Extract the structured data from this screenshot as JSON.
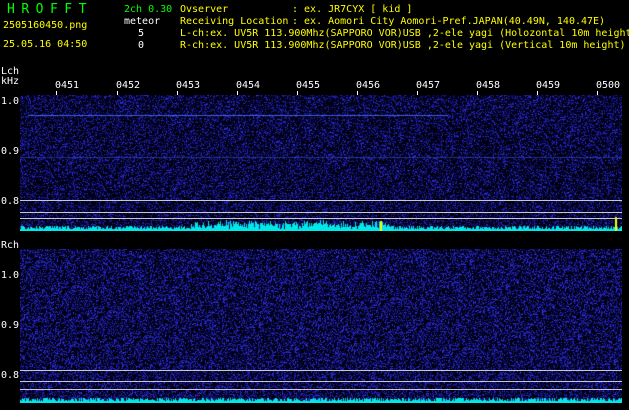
{
  "header": {
    "app_title": "HROFFT",
    "mode": "2ch 0.30",
    "filename": "2505160450.png",
    "meteor_label": "meteor",
    "datetime": "25.05.16 04:50",
    "count_l": "5",
    "count_r": "0",
    "observer_label": "Ovserver",
    "observer_value": ": ex. JR7CYX [ kid ]",
    "location_label": "Receiving Location",
    "location_value": ": ex. Aomori City Aomori-Pref.JAPAN(40.49N, 140.47E)",
    "lch_info": "L-ch:ex. UV5R 113.900Mhz(SAPPORO VOR)USB ,2-ele yagi (Holozontal 10m height)",
    "rch_info": "R-ch:ex. UV5R 113.900Mhz(SAPPORO VOR)USB ,2-ele yagi (Vertical 10m height)"
  },
  "lch": {
    "label": "Lch",
    "unit": "kHz",
    "y_ticks": [
      "1.0",
      "0.9",
      "0.8"
    ]
  },
  "rch": {
    "label": "Rch",
    "y_ticks": [
      "1.0",
      "0.9",
      "0.8"
    ]
  },
  "time_ticks": [
    "0451",
    "0452",
    "0453",
    "0454",
    "0455",
    "0456",
    "0457",
    "0458",
    "0459",
    "0500"
  ],
  "colors": {
    "background": "#000000",
    "noise": "#1a1ab4",
    "signal": "#00ffff",
    "title": "#00ff00",
    "info": "#ffff00",
    "text": "#ffffff"
  }
}
